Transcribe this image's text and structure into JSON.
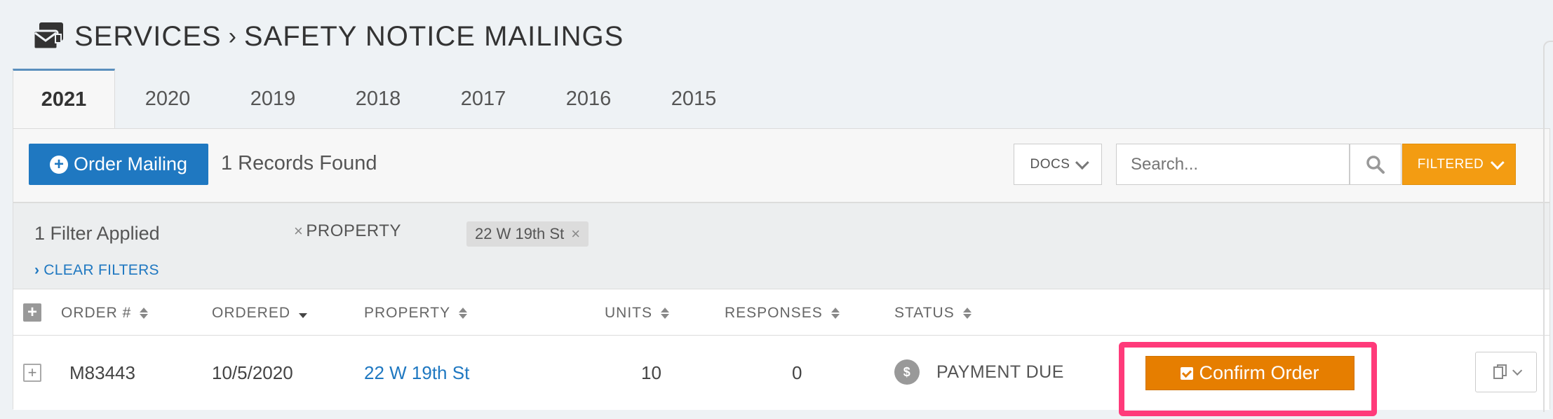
{
  "header": {
    "icon": "mail-folder-icon",
    "section": "SERVICES",
    "separator": "›",
    "page": "SAFETY NOTICE MAILINGS"
  },
  "tabs": [
    {
      "label": "2021",
      "active": true
    },
    {
      "label": "2020"
    },
    {
      "label": "2019"
    },
    {
      "label": "2018"
    },
    {
      "label": "2017"
    },
    {
      "label": "2016"
    },
    {
      "label": "2015"
    }
  ],
  "toolbar": {
    "order_label": "Order Mailing",
    "records_found": "1 Records Found",
    "docs_label": "DOCS",
    "search_placeholder": "Search...",
    "filtered_label": "FILTERED"
  },
  "filters": {
    "count_text": "1 Filter Applied",
    "field_label": "PROPERTY",
    "field_remove": "×",
    "tag_value": "22 W 19th St",
    "tag_remove": "×",
    "clear_label": "CLEAR FILTERS"
  },
  "table": {
    "expand_all": "+",
    "columns": [
      "ORDER #",
      "ORDERED",
      "PROPERTY",
      "UNITS",
      "RESPONSES",
      "STATUS"
    ],
    "rows": [
      {
        "expand": "+",
        "order": "M83443",
        "ordered": "10/5/2020",
        "property": "22 W 19th St",
        "units": "10",
        "responses": "0",
        "status_icon": "$",
        "status": "PAYMENT DUE",
        "action_label": "Confirm Order"
      }
    ]
  },
  "colors": {
    "primary_blue": "#1f78c1",
    "filtered_orange": "#f39c12",
    "confirm_orange": "#e67e00",
    "highlight_pink": "#ff3a7a"
  }
}
